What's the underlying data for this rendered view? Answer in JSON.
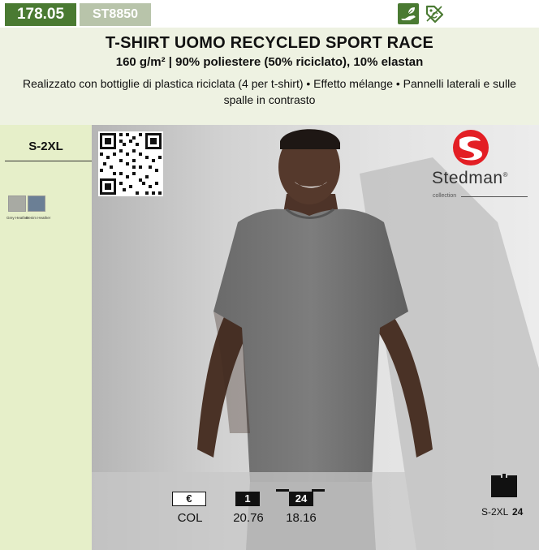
{
  "header": {
    "code": "178.05",
    "reference": "ST8850",
    "title": "T-SHIRT UOMO RECYCLED SPORT RACE",
    "subtitle": "160 g/m² | 90% poliestere (50% riciclato), 10% elastan",
    "description": "Realizzato con bottiglie di plastica riciclata (4 per t-shirt) • Effetto mélange • Pannelli laterali e sulle spalle in contrasto",
    "eco_icons": [
      "eco-hand-leaf-icon",
      "recycled-tag-icon"
    ]
  },
  "sidebar": {
    "sizes": "S-2XL",
    "colors": [
      {
        "name": "Grey Heather",
        "hex": "#a8aaa3"
      },
      {
        "name": "Denim Heather",
        "hex": "#6b7f95"
      }
    ]
  },
  "brand": {
    "name": "Stedman",
    "sub": "collection",
    "registered": "®",
    "logo_color": "#e31e24"
  },
  "pricing": {
    "currency": "€",
    "row_label": "COL",
    "tiers": [
      {
        "qty": "1",
        "price": "20.76"
      },
      {
        "qty": "24",
        "price": "18.16"
      }
    ]
  },
  "carton": {
    "sizes": "S-2XL",
    "qty": "24"
  },
  "colors": {
    "accent_green": "#4a7a32",
    "reference_green": "#b8c4aa",
    "header_bg": "#eef2e2",
    "sidebar_bg": "#e6efc9"
  }
}
